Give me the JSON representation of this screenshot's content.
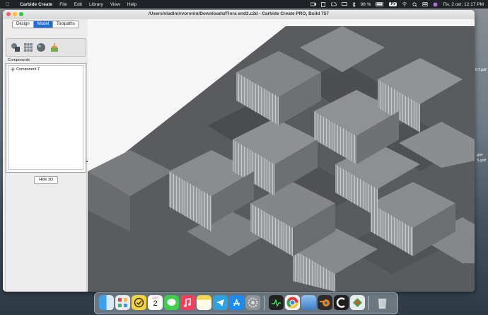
{
  "menubar": {
    "app_name": "Carbide Create",
    "menus": [
      "File",
      "Edit",
      "Library",
      "View",
      "Help"
    ],
    "battery": "98 %",
    "keyboard": "РУ",
    "datetime": "Пн, 2 окт.  12:17 PM"
  },
  "window": {
    "title": "/Users/vladimirvoronin/Downloads/Flora end2.c2d - Carbide Create PRO, Build 757"
  },
  "tabs": [
    {
      "label": "Design"
    },
    {
      "label": "Model",
      "active": true
    },
    {
      "label": "Toolpaths"
    }
  ],
  "tools": [
    "shape-tool-icon",
    "grid-tool-icon",
    "sphere-tool-icon",
    "import-tool-icon"
  ],
  "components": {
    "label": "Components",
    "items": [
      {
        "label": "Component 7"
      }
    ]
  },
  "hide3d_label": "Hide 3D",
  "desktop_right_labels": [
    "ET.pdf",
    "gov",
    "S.pdf"
  ],
  "dock": {
    "calendar_day": "2",
    "calendar_month": "ОКТ"
  },
  "colors": {
    "accent": "#1e6fd9",
    "model_top": "#8a8b8d",
    "model_shadow": "#5d5e60"
  }
}
